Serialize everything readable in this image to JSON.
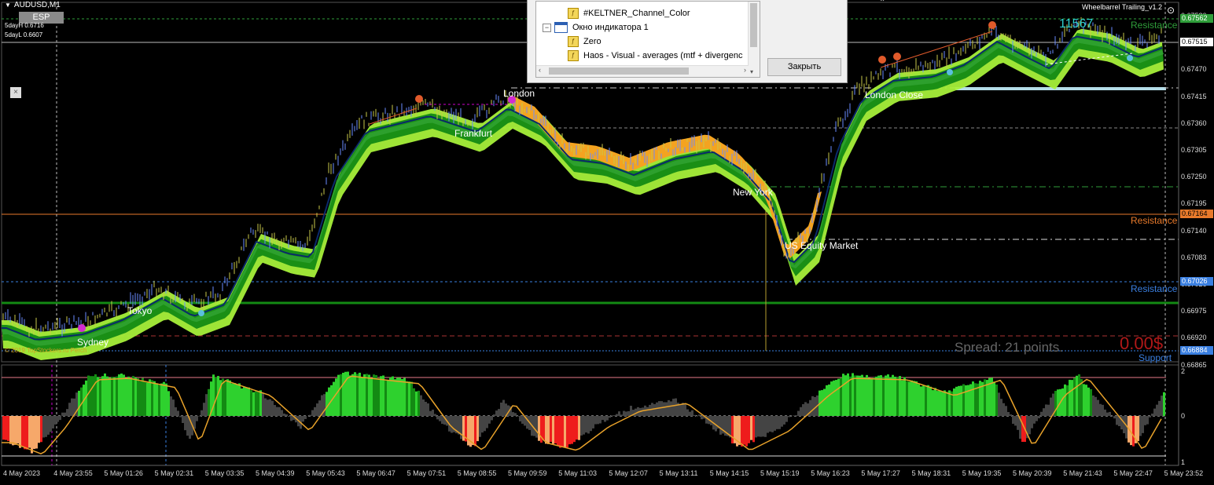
{
  "symbol": "AUDUSD,M1",
  "esp_badge": "ESP",
  "day_high": "5dayH 0.6716",
  "day_low": "5dayL 0.6607",
  "trailing_label": "Wheelbarrel Trailing_v1.2",
  "copyright": "© 2019 TopStockers.ru Perch",
  "spread": "Spread: 21 points.",
  "profit": "0.00$",
  "counter": "11567",
  "close_x": "×",
  "price_axis": [
    "0.67580",
    "0.67525",
    "0.67470",
    "0.67415",
    "0.67360",
    "0.67305",
    "0.67250",
    "0.67195",
    "0.67140",
    "0.67083",
    "0.67026",
    "0.66975",
    "0.66920",
    "0.66865"
  ],
  "price_tags": {
    "top": "0.67562",
    "current": "0.67515",
    "orange": "0.67164",
    "blue": "0.67026",
    "support": "0.66884"
  },
  "osc_axis": [
    "2",
    "0",
    "1"
  ],
  "time_axis": [
    "4 May 2023",
    "4 May 23:55",
    "5 May 01:26",
    "5 May 02:31",
    "5 May 03:35",
    "5 May 04:39",
    "5 May 05:43",
    "5 May 06:47",
    "5 May 07:51",
    "5 May 08:55",
    "5 May 09:59",
    "5 May 11:03",
    "5 May 12:07",
    "5 May 13:11",
    "5 May 14:15",
    "5 May 15:19",
    "5 May 16:23",
    "5 May 17:27",
    "5 May 18:31",
    "5 May 19:35",
    "5 May 20:39",
    "5 May 21:43",
    "5 May 22:47",
    "5 May 23:52"
  ],
  "sessions": {
    "sydney": "Sydney",
    "tokyo": "Tokyo",
    "frankfurt": "Frankfurt",
    "london": "London",
    "new_york": "New York",
    "us_equity": "US Equity Market",
    "london_close": "London Close"
  },
  "levels": {
    "resistance_1": "Resistance",
    "resistance_2": "Resistance",
    "resistance_3": "Resistance",
    "support": "Support"
  },
  "dialog": {
    "items": [
      {
        "label": "#KELTNER_Channel_Color",
        "kind": "indicator"
      },
      {
        "label": "Окно индикатора 1",
        "kind": "window"
      },
      {
        "label": "Zero",
        "kind": "indicator"
      },
      {
        "label": "Haos - Visual - averages (mtf + divergenc",
        "kind": "indicator"
      }
    ],
    "close_button": "Закрыть"
  },
  "colors": {
    "bull_channel": "#2ea12e",
    "light_channel": "#a6f03a",
    "bear_channel": "#f4a320",
    "resistance_green": "#2f9e3a",
    "resistance_orange": "#e87a2b",
    "resistance_blue": "#3a7fe0",
    "osc_up": "#2ed12e",
    "osc_down": "#ee1c1c",
    "osc_line": "#e8a22a"
  }
}
